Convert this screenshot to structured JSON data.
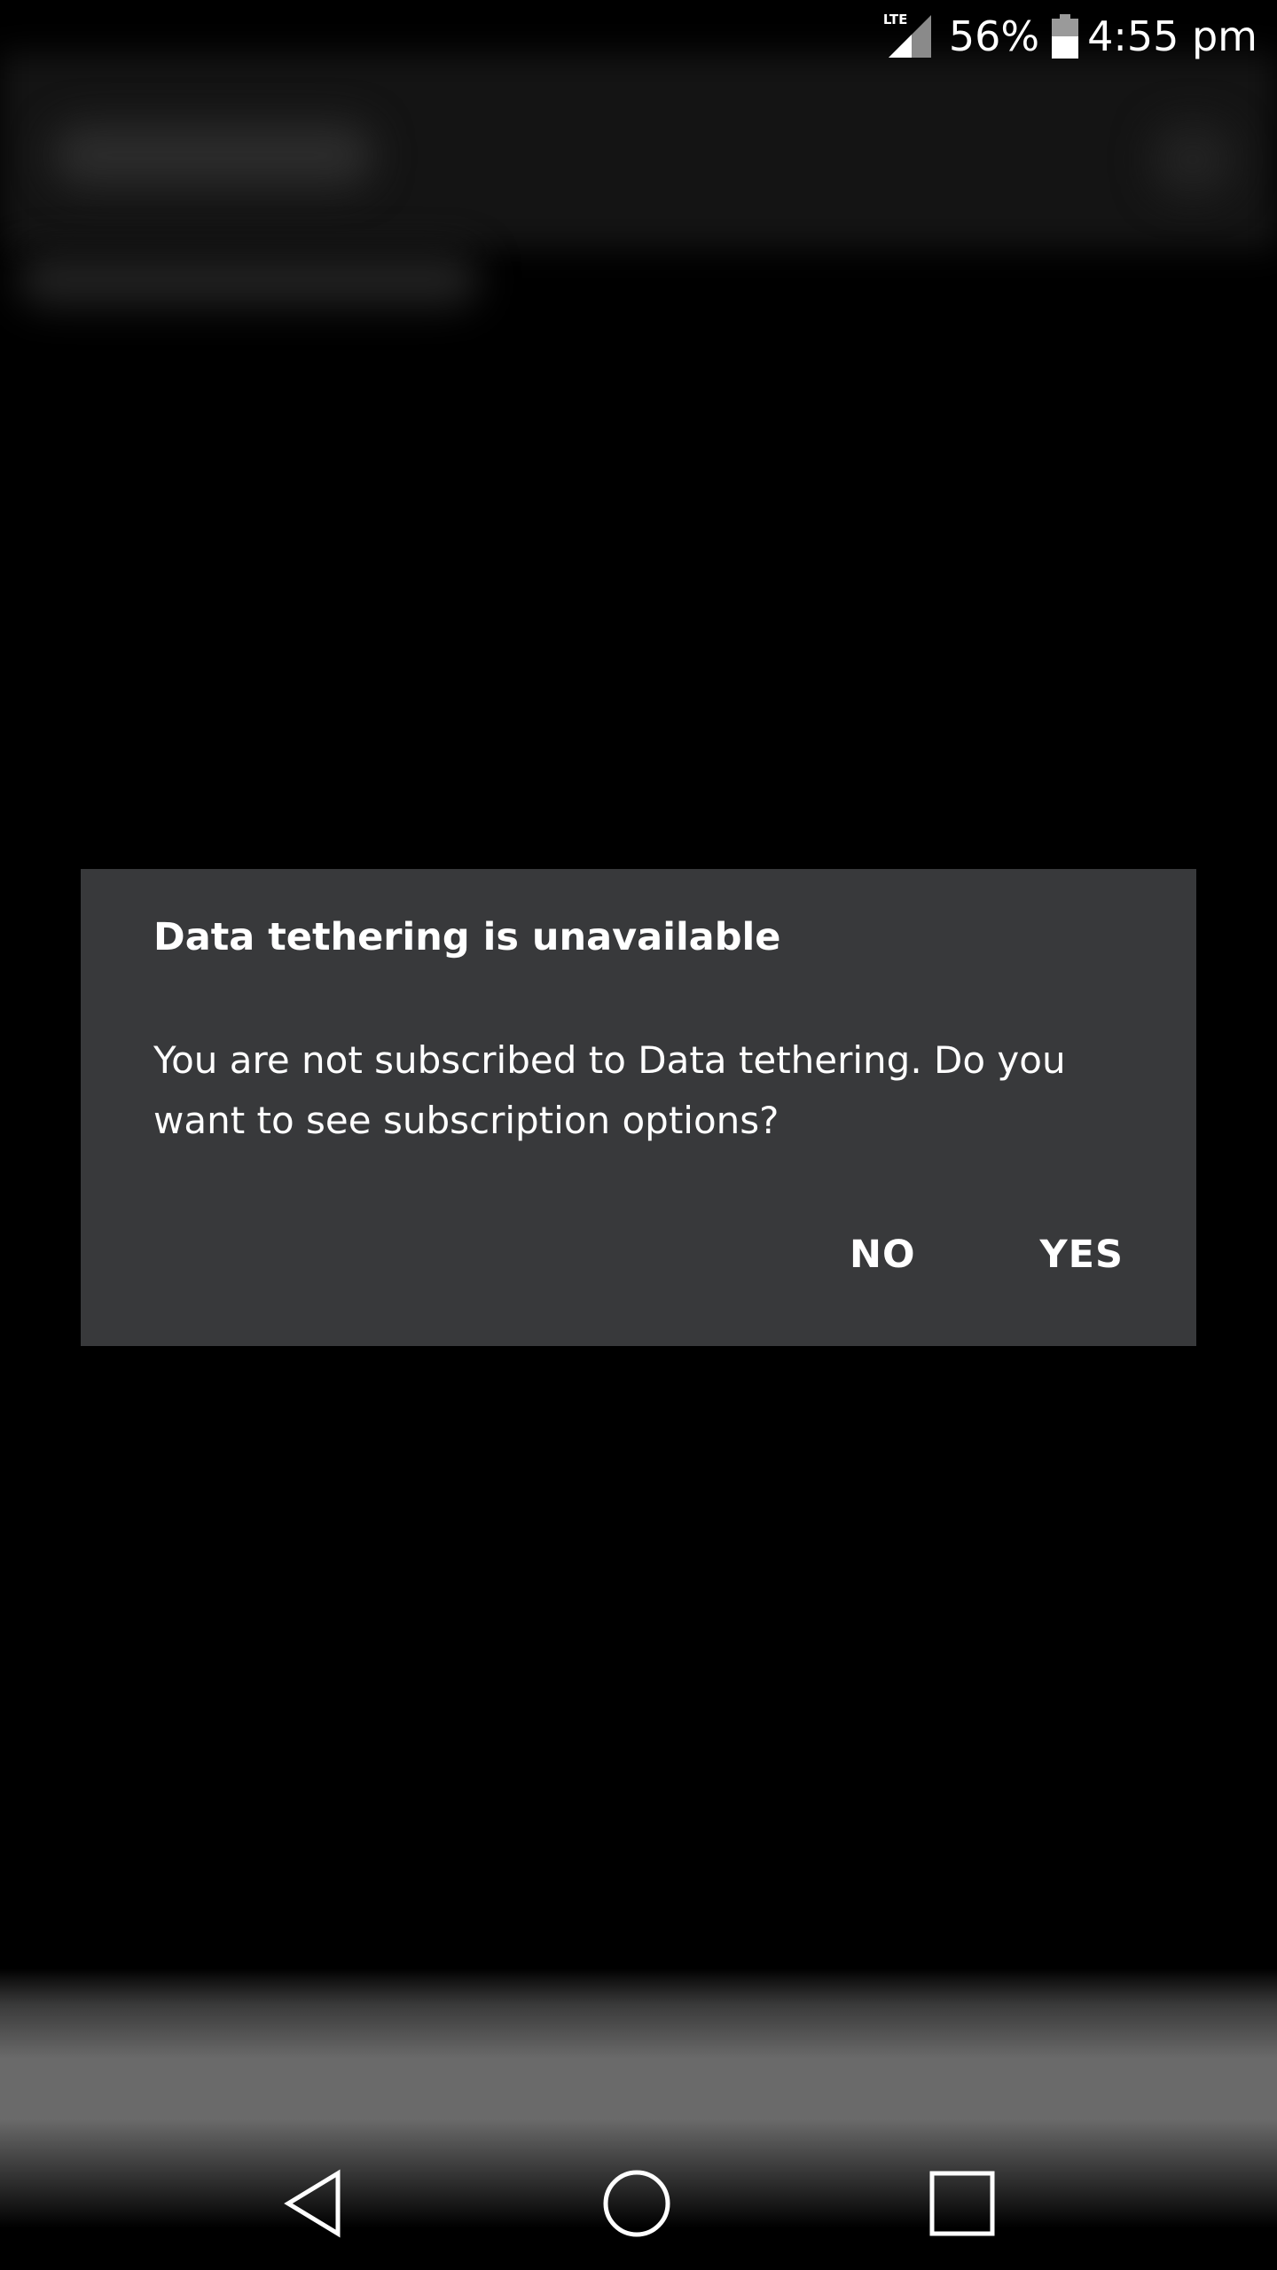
{
  "status_bar": {
    "network_type": "LTE",
    "battery_percent": "56%",
    "battery_level": 0.56,
    "time": "4:55 pm"
  },
  "dialog": {
    "title": "Data tethering is unavailable",
    "message": "You are not subscribed to Data tethering. Do you want to see subscription options?",
    "negative_label": "NO",
    "positive_label": "YES",
    "background_color": "#38393b"
  },
  "nav_bar": {
    "back_icon": "back-triangle-icon",
    "home_icon": "home-circle-icon",
    "recents_icon": "recents-square-icon"
  }
}
